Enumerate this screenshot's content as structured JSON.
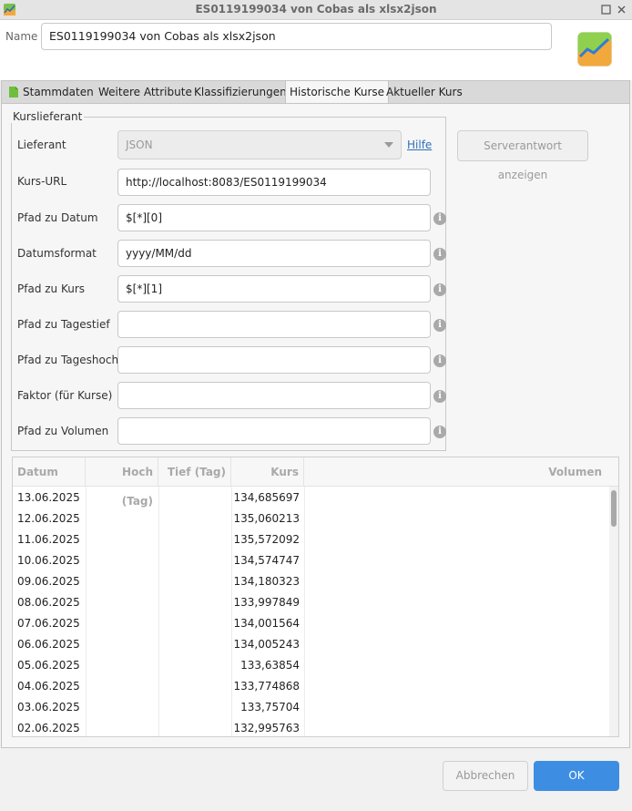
{
  "window": {
    "title": "ES0119199034 von Cobas als xlsx2json",
    "app_icon": "portfolio-performance-icon",
    "buttons": [
      "maximize-icon",
      "close-icon"
    ]
  },
  "name_bar": {
    "label": "Name",
    "value": "ES0119199034 von Cobas als xlsx2json",
    "logo": "portfolio-chart-logo"
  },
  "tabs": [
    {
      "label": "Stammdaten",
      "icon": "document-icon",
      "active": false
    },
    {
      "label": "Weitere Attribute",
      "active": false
    },
    {
      "label": "Klassifizierungen",
      "active": false
    },
    {
      "label": "Historische Kurse",
      "active": true
    },
    {
      "label": "Aktueller Kurs",
      "active": false
    }
  ],
  "provider_group": {
    "title": "Kurslieferant",
    "lieferant": {
      "label": "Lieferant",
      "value": "JSON"
    },
    "help_link": "Hilfe",
    "server_button": "Serverantwort anzeigen",
    "fields": [
      {
        "label": "Kurs-URL",
        "value": "http://localhost:8083/ES0119199034",
        "info": false
      },
      {
        "label": "Pfad zu Datum",
        "value": "$[*][0]",
        "info": true
      },
      {
        "label": "Datumsformat",
        "value": "yyyy/MM/dd",
        "info": true
      },
      {
        "label": "Pfad zu Kurs",
        "value": "$[*][1]",
        "info": true
      },
      {
        "label": "Pfad zu Tagestief",
        "value": "",
        "info": true
      },
      {
        "label": "Pfad zu Tageshoch",
        "value": "",
        "info": true
      },
      {
        "label": "Faktor (für Kurse)",
        "value": "",
        "info": true
      },
      {
        "label": "Pfad zu Volumen",
        "value": "",
        "info": true
      }
    ],
    "info_glyph": "i"
  },
  "table": {
    "columns": [
      "Datum",
      "Hoch (Tag)",
      "Tief (Tag)",
      "Kurs",
      "Volumen"
    ],
    "rows": [
      {
        "datum": "13.06.2025",
        "hoch": "",
        "tief": "",
        "kurs": "134,685697",
        "volumen": ""
      },
      {
        "datum": "12.06.2025",
        "hoch": "",
        "tief": "",
        "kurs": "135,060213",
        "volumen": ""
      },
      {
        "datum": "11.06.2025",
        "hoch": "",
        "tief": "",
        "kurs": "135,572092",
        "volumen": ""
      },
      {
        "datum": "10.06.2025",
        "hoch": "",
        "tief": "",
        "kurs": "134,574747",
        "volumen": ""
      },
      {
        "datum": "09.06.2025",
        "hoch": "",
        "tief": "",
        "kurs": "134,180323",
        "volumen": ""
      },
      {
        "datum": "08.06.2025",
        "hoch": "",
        "tief": "",
        "kurs": "133,997849",
        "volumen": ""
      },
      {
        "datum": "07.06.2025",
        "hoch": "",
        "tief": "",
        "kurs": "134,001564",
        "volumen": ""
      },
      {
        "datum": "06.06.2025",
        "hoch": "",
        "tief": "",
        "kurs": "134,005243",
        "volumen": ""
      },
      {
        "datum": "05.06.2025",
        "hoch": "",
        "tief": "",
        "kurs": "133,63854",
        "volumen": ""
      },
      {
        "datum": "04.06.2025",
        "hoch": "",
        "tief": "",
        "kurs": "133,774868",
        "volumen": ""
      },
      {
        "datum": "03.06.2025",
        "hoch": "",
        "tief": "",
        "kurs": "133,75704",
        "volumen": ""
      },
      {
        "datum": "02.06.2025",
        "hoch": "",
        "tief": "",
        "kurs": "132,995763",
        "volumen": ""
      }
    ]
  },
  "footer": {
    "cancel": "Abbrechen",
    "ok": "OK"
  },
  "colors": {
    "accent": "#3d8ee3",
    "link": "#2f6fb8",
    "info_icon": "#a9a9a9"
  }
}
